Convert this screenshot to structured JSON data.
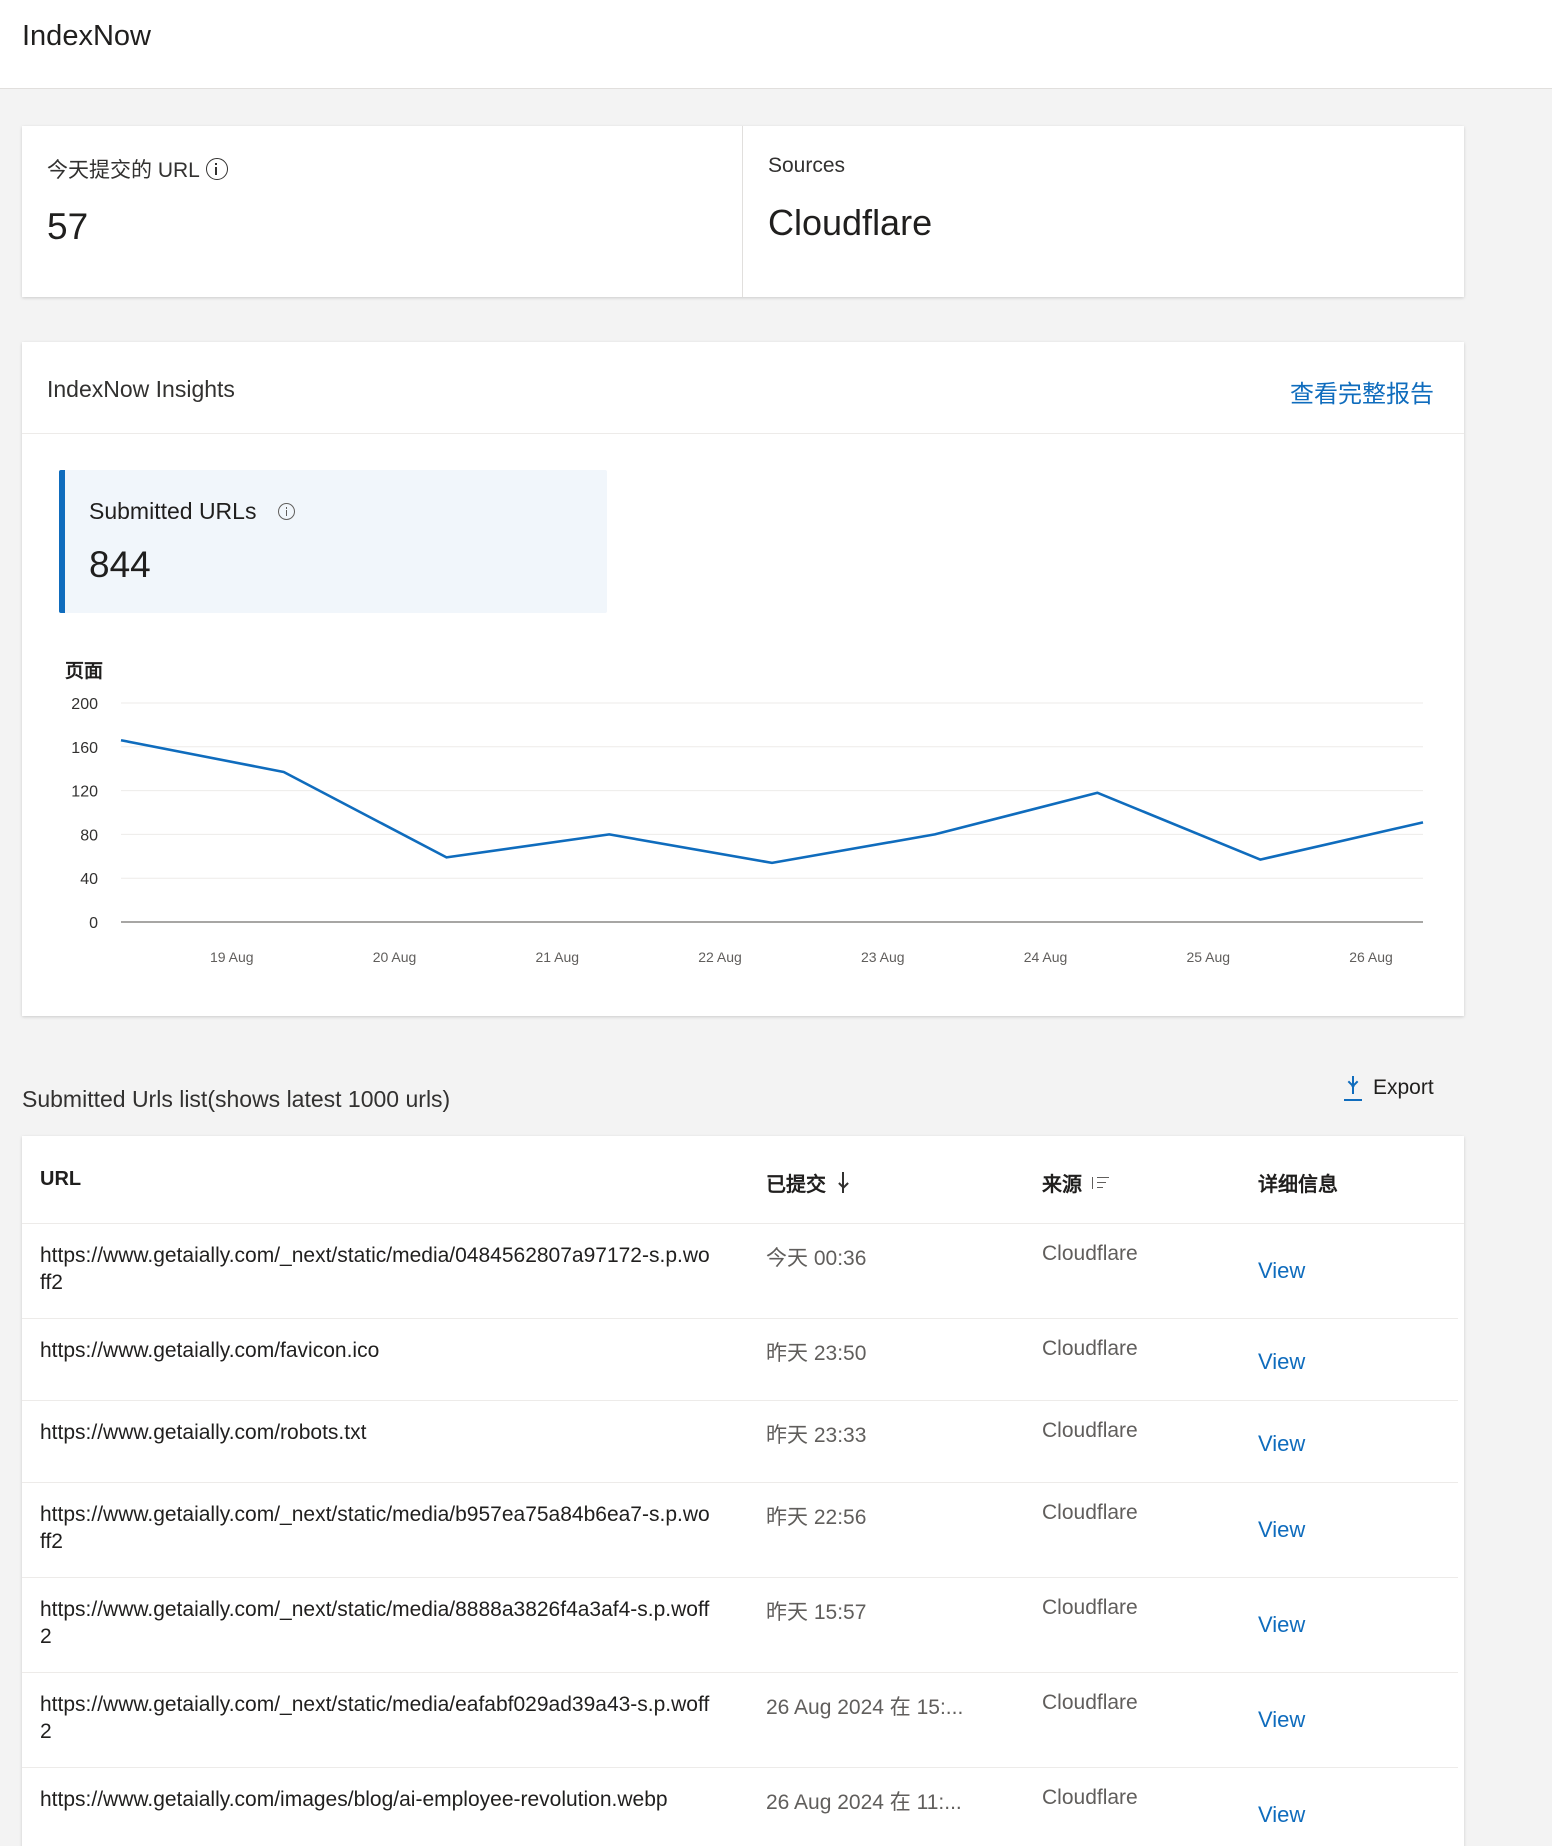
{
  "app": {
    "title": "IndexNow"
  },
  "summary": {
    "today_label": "今天提交的 URL",
    "today_value": "57",
    "sources_label": "Sources",
    "sources_value": "Cloudflare"
  },
  "insights": {
    "title": "IndexNow Insights",
    "full_report_link": "查看完整报告",
    "metric_label": "Submitted URLs",
    "metric_value": "844"
  },
  "chart_data": {
    "type": "line",
    "ylabel": "页面",
    "ylim": [
      0,
      200
    ],
    "yticks": [
      0,
      40,
      80,
      120,
      160,
      200
    ],
    "xticks": [
      "19 Aug",
      "20 Aug",
      "21 Aug",
      "22 Aug",
      "23 Aug",
      "24 Aug",
      "25 Aug",
      "26 Aug"
    ],
    "x": [
      "18 Aug",
      "19 Aug",
      "20 Aug",
      "21 Aug",
      "22 Aug",
      "23 Aug",
      "24 Aug",
      "25 Aug",
      "26 Aug"
    ],
    "values": [
      166,
      137,
      59,
      80,
      54,
      80,
      118,
      57,
      91
    ],
    "color": "#0f6cbd",
    "grid": true,
    "legend": "none"
  },
  "list": {
    "title": "Submitted Urls list(shows latest 1000 urls)",
    "export_label": "Export",
    "columns": {
      "url": "URL",
      "submitted": "已提交",
      "source": "来源",
      "details": "详细信息"
    },
    "rows": [
      {
        "url": "https://www.getaially.com/_next/static/media/0484562807a97172-s.p.woff2",
        "date": "今天 00:36",
        "source": "Cloudflare",
        "view": "View"
      },
      {
        "url": "https://www.getaially.com/favicon.ico",
        "date": "昨天 23:50",
        "source": "Cloudflare",
        "view": "View"
      },
      {
        "url": "https://www.getaially.com/robots.txt",
        "date": "昨天 23:33",
        "source": "Cloudflare",
        "view": "View"
      },
      {
        "url": "https://www.getaially.com/_next/static/media/b957ea75a84b6ea7-s.p.woff2",
        "date": "昨天 22:56",
        "source": "Cloudflare",
        "view": "View"
      },
      {
        "url": "https://www.getaially.com/_next/static/media/8888a3826f4a3af4-s.p.woff2",
        "date": "昨天 15:57",
        "source": "Cloudflare",
        "view": "View"
      },
      {
        "url": "https://www.getaially.com/_next/static/media/eafabf029ad39a43-s.p.woff2",
        "date": "26 Aug 2024 在 15:...",
        "source": "Cloudflare",
        "view": "View"
      },
      {
        "url": "https://www.getaially.com/images/blog/ai-employee-revolution.webp",
        "date": "26 Aug 2024 在 11:...",
        "source": "Cloudflare",
        "view": "View"
      }
    ]
  }
}
